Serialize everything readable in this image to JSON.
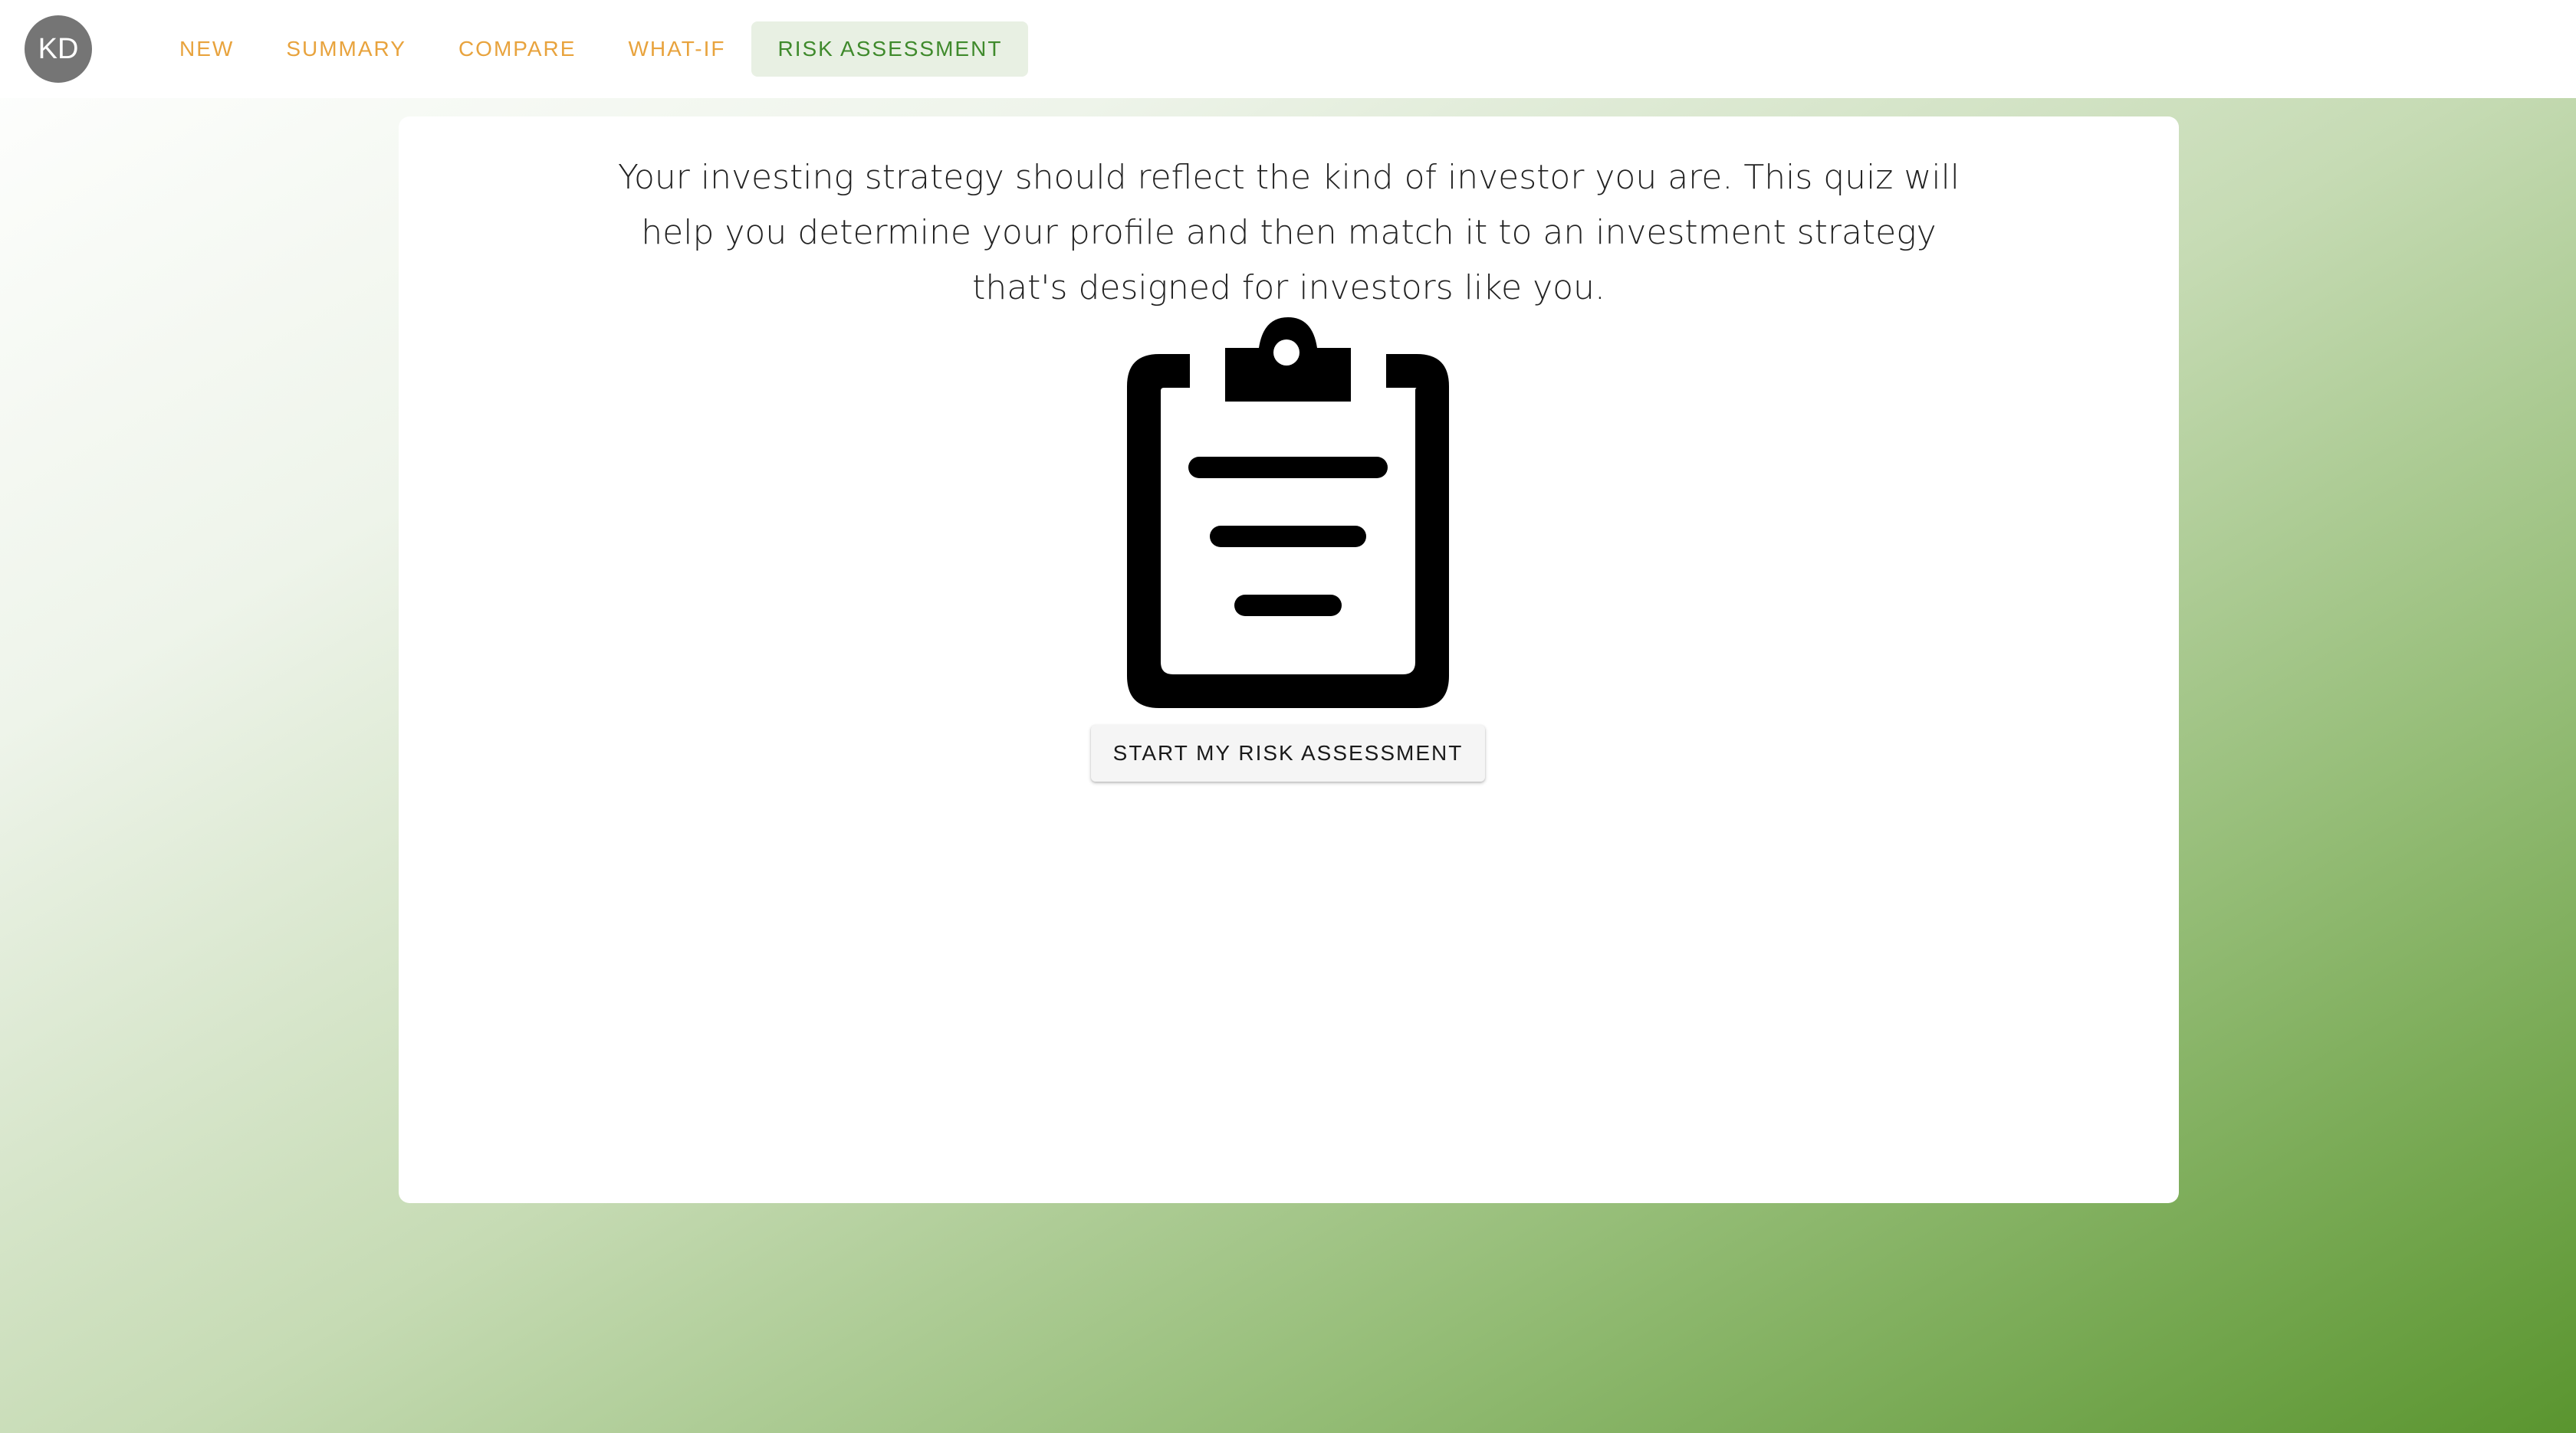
{
  "user": {
    "initials": "KD"
  },
  "nav": {
    "tabs": [
      {
        "label": "NEW",
        "active": false
      },
      {
        "label": "SUMMARY",
        "active": false
      },
      {
        "label": "COMPARE",
        "active": false
      },
      {
        "label": "WHAT-IF",
        "active": false
      },
      {
        "label": "RISK ASSESSMENT",
        "active": true
      }
    ]
  },
  "main": {
    "intro_lines": [
      "Your investing strategy should reflect the kind of investor you are. This quiz will",
      "help you determine your profile and then match it to an investment strategy",
      "that's designed for investors like you."
    ],
    "illustration_icon": "clipboard-icon",
    "start_button_label": "START MY RISK ASSESSMENT"
  },
  "colors": {
    "tab_inactive": "#e8a33d",
    "tab_active": "#3f8a2c",
    "tab_active_bg": "#e8f0e3",
    "avatar_bg": "#757575",
    "gradient_end": "#5a952f"
  }
}
